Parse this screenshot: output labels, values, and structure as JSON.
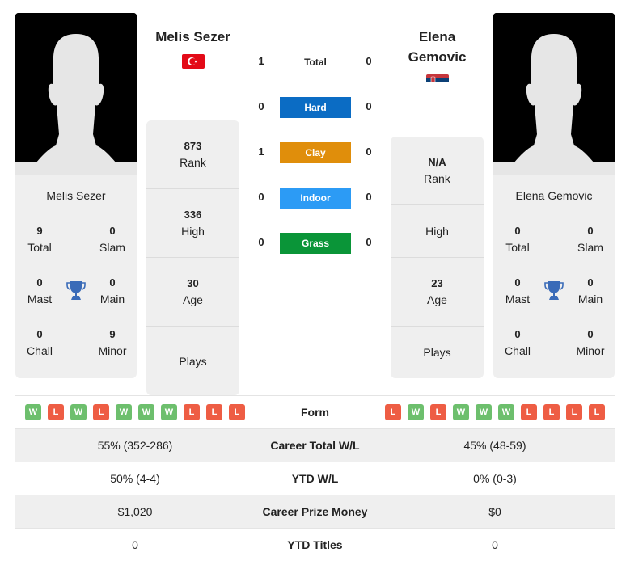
{
  "colors": {
    "hard": "#0b6cc4",
    "clay": "#e08e0b",
    "indoor": "#2c9bf5",
    "grass": "#0a9538",
    "win": "#6dbf6d",
    "loss": "#ee5d44",
    "trophy": "#3a6bb8"
  },
  "player1": {
    "name": "Melis Sezer",
    "header_name": "Melis Sezer",
    "flag": "turkey-flag",
    "titles": {
      "total": {
        "value": "9",
        "label": "Total"
      },
      "slam": {
        "value": "0",
        "label": "Slam"
      },
      "mast": {
        "value": "0",
        "label": "Mast"
      },
      "main": {
        "value": "0",
        "label": "Main"
      },
      "chall": {
        "value": "0",
        "label": "Chall"
      },
      "minor": {
        "value": "9",
        "label": "Minor"
      }
    },
    "rank": {
      "value": "873",
      "label": "Rank"
    },
    "high": {
      "value": "336",
      "label": "High"
    },
    "age": {
      "value": "30",
      "label": "Age"
    },
    "plays": {
      "value": "",
      "label": "Plays"
    },
    "form": [
      "W",
      "L",
      "W",
      "L",
      "W",
      "W",
      "W",
      "L",
      "L",
      "L"
    ]
  },
  "player2": {
    "name": "Elena Gemovic",
    "header_name_line1": "Elena",
    "header_name_line2": "Gemovic",
    "flag": "serbia-flag",
    "titles": {
      "total": {
        "value": "0",
        "label": "Total"
      },
      "slam": {
        "value": "0",
        "label": "Slam"
      },
      "mast": {
        "value": "0",
        "label": "Mast"
      },
      "main": {
        "value": "0",
        "label": "Main"
      },
      "chall": {
        "value": "0",
        "label": "Chall"
      },
      "minor": {
        "value": "0",
        "label": "Minor"
      }
    },
    "rank": {
      "value": "N/A",
      "label": "Rank"
    },
    "high": {
      "value": "",
      "label": "High"
    },
    "age": {
      "value": "23",
      "label": "Age"
    },
    "plays": {
      "value": "",
      "label": "Plays"
    },
    "form": [
      "L",
      "W",
      "L",
      "W",
      "W",
      "W",
      "L",
      "L",
      "L",
      "L"
    ]
  },
  "h2h": {
    "total": {
      "label": "Total",
      "p1": "1",
      "p2": "0"
    },
    "surfaces": [
      {
        "label": "Hard",
        "p1": "0",
        "p2": "0",
        "color_key": "hard"
      },
      {
        "label": "Clay",
        "p1": "1",
        "p2": "0",
        "color_key": "clay"
      },
      {
        "label": "Indoor",
        "p1": "0",
        "p2": "0",
        "color_key": "indoor"
      },
      {
        "label": "Grass",
        "p1": "0",
        "p2": "0",
        "color_key": "grass"
      }
    ]
  },
  "comparison": {
    "form_label": "Form",
    "rows": [
      {
        "label": "Career Total W/L",
        "p1": "55% (352-286)",
        "p2": "45% (48-59)"
      },
      {
        "label": "YTD W/L",
        "p1": "50% (4-4)",
        "p2": "0% (0-3)"
      },
      {
        "label": "Career Prize Money",
        "p1": "$1,020",
        "p2": "$0"
      },
      {
        "label": "YTD Titles",
        "p1": "0",
        "p2": "0"
      }
    ]
  }
}
